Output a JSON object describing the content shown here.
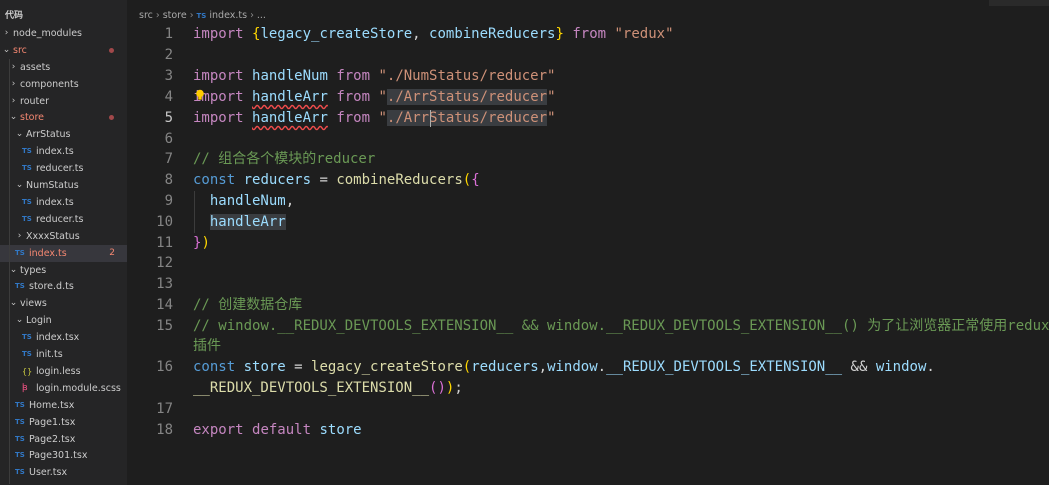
{
  "sidebar": {
    "items": [
      {
        "label": "代码",
        "indent": 0,
        "kind": "header",
        "chevron": ""
      },
      {
        "label": "node_modules",
        "indent": 0,
        "kind": "folder",
        "chevron": "›"
      },
      {
        "label": "src",
        "indent": 0,
        "kind": "folder",
        "chevron": "⌄",
        "red": true,
        "dot": true
      },
      {
        "label": "assets",
        "indent": 1,
        "kind": "folder",
        "chevron": "›"
      },
      {
        "label": "components",
        "indent": 1,
        "kind": "folder",
        "chevron": "›"
      },
      {
        "label": "router",
        "indent": 1,
        "kind": "folder",
        "chevron": "›"
      },
      {
        "label": "store",
        "indent": 1,
        "kind": "folder",
        "chevron": "⌄",
        "red": true,
        "dot": true
      },
      {
        "label": "ArrStatus",
        "indent": 2,
        "kind": "folder",
        "chevron": "⌄"
      },
      {
        "label": "index.ts",
        "indent": 3,
        "kind": "ts"
      },
      {
        "label": "reducer.ts",
        "indent": 3,
        "kind": "ts"
      },
      {
        "label": "NumStatus",
        "indent": 2,
        "kind": "folder",
        "chevron": "⌄"
      },
      {
        "label": "index.ts",
        "indent": 3,
        "kind": "ts"
      },
      {
        "label": "reducer.ts",
        "indent": 3,
        "kind": "ts"
      },
      {
        "label": "XxxxStatus",
        "indent": 2,
        "kind": "folder",
        "chevron": "›"
      },
      {
        "label": "index.ts",
        "indent": 2,
        "kind": "ts",
        "red": true,
        "active": true,
        "count": "2"
      },
      {
        "label": "types",
        "indent": 1,
        "kind": "folder",
        "chevron": "⌄"
      },
      {
        "label": "store.d.ts",
        "indent": 2,
        "kind": "ts"
      },
      {
        "label": "views",
        "indent": 1,
        "kind": "folder",
        "chevron": "⌄"
      },
      {
        "label": "Login",
        "indent": 2,
        "kind": "folder",
        "chevron": "⌄"
      },
      {
        "label": "index.tsx",
        "indent": 3,
        "kind": "ts"
      },
      {
        "label": "init.ts",
        "indent": 3,
        "kind": "ts"
      },
      {
        "label": "login.less",
        "indent": 3,
        "kind": "less"
      },
      {
        "label": "login.module.scss",
        "indent": 3,
        "kind": "scss"
      },
      {
        "label": "Home.tsx",
        "indent": 2,
        "kind": "ts"
      },
      {
        "label": "Page1.tsx",
        "indent": 2,
        "kind": "ts"
      },
      {
        "label": "Page2.tsx",
        "indent": 2,
        "kind": "ts"
      },
      {
        "label": "Page301.tsx",
        "indent": 2,
        "kind": "ts"
      },
      {
        "label": "User.tsx",
        "indent": 2,
        "kind": "ts"
      }
    ]
  },
  "breadcrumb": {
    "p1": "src",
    "p2": "store",
    "ts": "TS",
    "p3": "index.ts",
    "p4": "..."
  },
  "icons": {
    "ts": "TS",
    "folder_open": "⌄",
    "folder_closed": "›",
    "less": "{}",
    "scss": "ꟓ"
  },
  "colors": {
    "keyword": "#c586c0",
    "string": "#ce9178",
    "comment": "#6a9955",
    "variable": "#9cdcfe",
    "function": "#dcdcaa",
    "accent_ts": "#3178c6",
    "error": "#f48771"
  },
  "editor": {
    "current_line": 5,
    "lines": [
      {
        "n": "1",
        "tokens": [
          [
            "kw",
            "import"
          ],
          [
            "pl",
            " "
          ],
          [
            "br1",
            "{"
          ],
          [
            "var",
            "legacy_createStore"
          ],
          [
            "pl",
            ", "
          ],
          [
            "var",
            "combineReducers"
          ],
          [
            "br1",
            "}"
          ],
          [
            "pl",
            " "
          ],
          [
            "kw",
            "from"
          ],
          [
            "pl",
            " "
          ],
          [
            "str",
            "\"redux\""
          ]
        ]
      },
      {
        "n": "2",
        "tokens": []
      },
      {
        "n": "3",
        "tokens": [
          [
            "kw",
            "import"
          ],
          [
            "pl",
            " "
          ],
          [
            "var",
            "handleNum"
          ],
          [
            "pl",
            " "
          ],
          [
            "kw",
            "from"
          ],
          [
            "pl",
            " "
          ],
          [
            "str",
            "\"./NumStatus/reducer\""
          ]
        ]
      },
      {
        "n": "4",
        "tokens": [
          [
            "kw",
            "import"
          ],
          [
            "pl",
            " "
          ],
          [
            "var squig",
            "handleArr"
          ],
          [
            "pl",
            " "
          ],
          [
            "kw",
            "from"
          ],
          [
            "pl",
            " "
          ],
          [
            "str",
            "\""
          ],
          [
            "str hl",
            "./ArrStatus/reducer"
          ],
          [
            "str",
            "\""
          ]
        ]
      },
      {
        "n": "5",
        "tokens": [
          [
            "kw",
            "import"
          ],
          [
            "pl",
            " "
          ],
          [
            "var squig",
            "handleArr"
          ],
          [
            "pl",
            " "
          ],
          [
            "kw",
            "from"
          ],
          [
            "pl",
            " "
          ],
          [
            "str",
            "\""
          ],
          [
            "str hl",
            "./ArrStatus/reducer"
          ],
          [
            "str",
            "\""
          ]
        ]
      },
      {
        "n": "6",
        "tokens": []
      },
      {
        "n": "7",
        "tokens": [
          [
            "cm",
            "// 组合各个模块的reducer"
          ]
        ]
      },
      {
        "n": "8",
        "tokens": [
          [
            "kwb",
            "const"
          ],
          [
            "pl",
            " "
          ],
          [
            "var",
            "reducers"
          ],
          [
            "pl",
            " = "
          ],
          [
            "fn",
            "combineReducers"
          ],
          [
            "br1",
            "("
          ],
          [
            "br2",
            "{"
          ]
        ]
      },
      {
        "n": "9",
        "tokens": [
          [
            "pl",
            "  "
          ],
          [
            "var",
            "handleNum"
          ],
          [
            "pl",
            ","
          ]
        ]
      },
      {
        "n": "10",
        "tokens": [
          [
            "pl",
            "  "
          ],
          [
            "var hl",
            "handleArr"
          ]
        ]
      },
      {
        "n": "11",
        "tokens": [
          [
            "br2",
            "}"
          ],
          [
            "br1",
            ")"
          ]
        ]
      },
      {
        "n": "12",
        "tokens": []
      },
      {
        "n": "13",
        "tokens": []
      },
      {
        "n": "14",
        "tokens": [
          [
            "cm",
            "// 创建数据仓库"
          ]
        ]
      },
      {
        "n": "15",
        "tokens": [
          [
            "cm",
            "// window.__REDUX_DEVTOOLS_EXTENSION__ && window.__REDUX_DEVTOOLS_EXTENSION__() 为了让浏览器正常使用redux"
          ]
        ]
      },
      {
        "n": "",
        "tokens": [
          [
            "cm",
            "插件"
          ]
        ]
      },
      {
        "n": "16",
        "tokens": [
          [
            "kwb",
            "const"
          ],
          [
            "pl",
            " "
          ],
          [
            "var",
            "store"
          ],
          [
            "pl",
            " = "
          ],
          [
            "fn",
            "legacy_createStore"
          ],
          [
            "br1",
            "("
          ],
          [
            "var",
            "reducers"
          ],
          [
            "pl",
            ","
          ],
          [
            "var",
            "window"
          ],
          [
            "pl",
            "."
          ],
          [
            "var",
            "__REDUX_DEVTOOLS_EXTENSION__"
          ],
          [
            "pl",
            " && "
          ],
          [
            "var",
            "window"
          ],
          [
            "pl",
            "."
          ]
        ]
      },
      {
        "n": "",
        "tokens": [
          [
            "fn",
            "__REDUX_DEVTOOLS_EXTENSION__"
          ],
          [
            "br2",
            "("
          ],
          [
            "br2",
            ")"
          ],
          [
            "br1",
            ")"
          ],
          [
            "pl",
            ";"
          ]
        ]
      },
      {
        "n": "17",
        "tokens": []
      },
      {
        "n": "18",
        "tokens": [
          [
            "kw",
            "export"
          ],
          [
            "pl",
            " "
          ],
          [
            "kw",
            "default"
          ],
          [
            "pl",
            " "
          ],
          [
            "var",
            "store"
          ]
        ]
      }
    ]
  }
}
